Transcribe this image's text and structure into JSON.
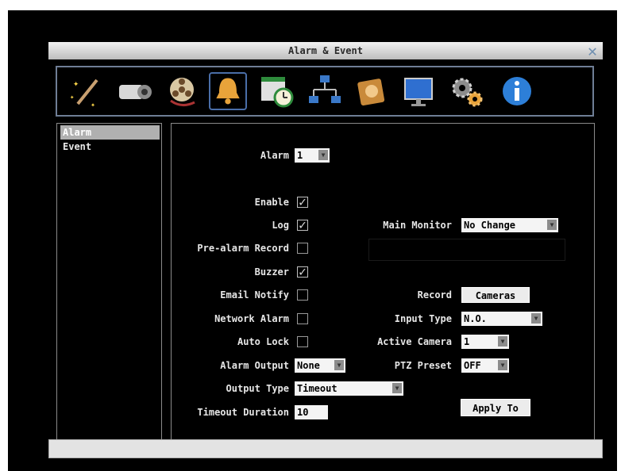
{
  "window": {
    "title": "Alarm & Event",
    "close_glyph": "✕"
  },
  "toolbar": {
    "icons": [
      "wand-icon",
      "camera-icon",
      "film-reel-icon",
      "bell-icon",
      "schedule-icon",
      "network-icon",
      "book-icon",
      "monitor-icon",
      "gears-icon",
      "info-icon"
    ],
    "selected": "bell-icon"
  },
  "sidebar": {
    "items": [
      {
        "label": "Alarm",
        "selected": true
      },
      {
        "label": "Event",
        "selected": false
      }
    ]
  },
  "form": {
    "alarm": {
      "label": "Alarm",
      "value": "1"
    },
    "enable": {
      "label": "Enable",
      "checked": true
    },
    "log": {
      "label": "Log",
      "checked": true
    },
    "prealarm": {
      "label": "Pre-alarm Record",
      "checked": false
    },
    "buzzer": {
      "label": "Buzzer",
      "checked": true
    },
    "email": {
      "label": "Email Notify",
      "checked": false
    },
    "network_alarm": {
      "label": "Network Alarm",
      "checked": false
    },
    "auto_lock": {
      "label": "Auto Lock",
      "checked": false
    },
    "alarm_output": {
      "label": "Alarm Output",
      "value": "None"
    },
    "output_type": {
      "label": "Output Type",
      "value": "Timeout"
    },
    "timeout_duration": {
      "label": "Timeout Duration",
      "value": "10"
    },
    "main_monitor": {
      "label": "Main Monitor",
      "value": "No Change"
    },
    "record": {
      "label": "Record",
      "button": "Cameras"
    },
    "input_type": {
      "label": "Input Type",
      "value": "N.O."
    },
    "active_camera": {
      "label": "Active Camera",
      "value": "1"
    },
    "ptz_preset": {
      "label": "PTZ Preset",
      "value": "OFF"
    },
    "apply_to": {
      "label": "Apply To"
    }
  },
  "colors": {
    "accent": "#4a6ea8",
    "panel_border": "#8a8a8a",
    "text": "#e6e6e6"
  }
}
